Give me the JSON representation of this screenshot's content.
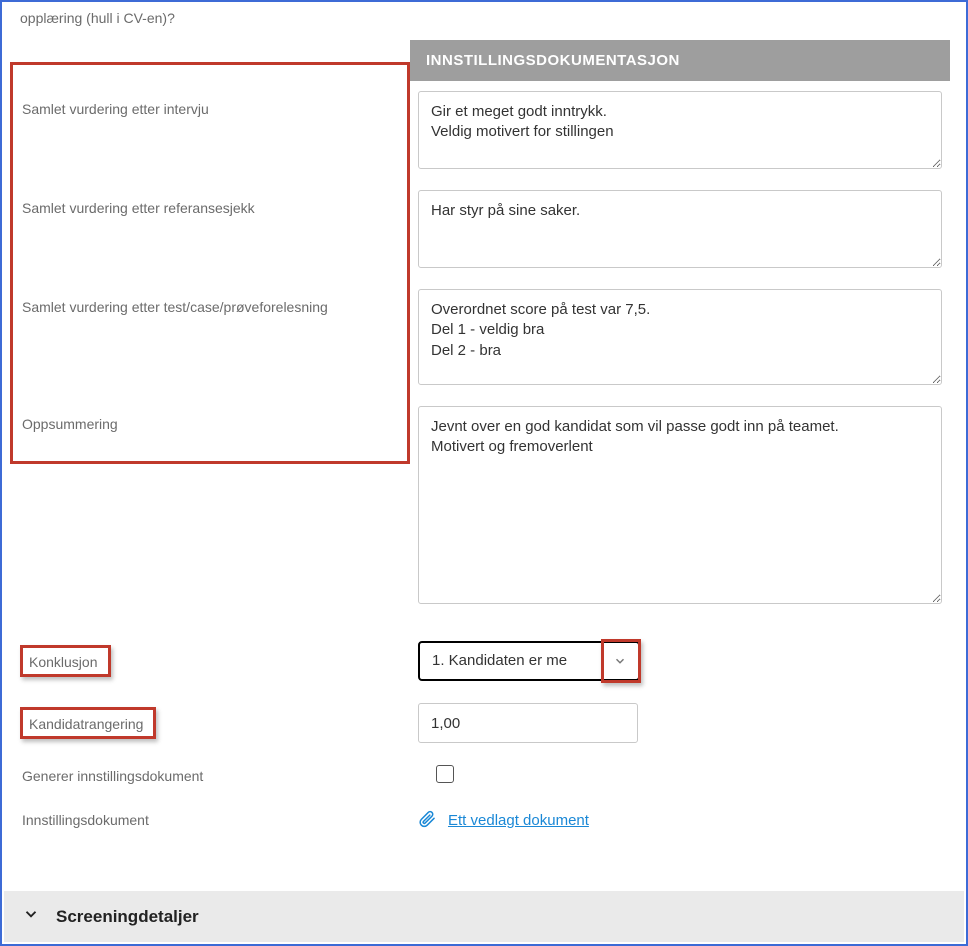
{
  "top_fragment": "opplæring (hull i CV-en)?",
  "section_header": "INNSTILLINGSDOKUMENTASJON",
  "labels": {
    "interview": "Samlet vurdering etter intervju",
    "reference": "Samlet vurdering etter referansesjekk",
    "testcase": "Samlet vurdering etter test/case/prøveforelesning",
    "summary": "Oppsummering",
    "conclusion": "Konklusjon",
    "ranking": "Kandidatrangering",
    "generate": "Generer innstillingsdokument",
    "document": "Innstillingsdokument"
  },
  "values": {
    "interview": "Gir et meget godt inntrykk.\nVeldig motivert for stillingen",
    "reference": "Har styr på sine saker.",
    "testcase": "Overordnet score på test var 7,5.\nDel 1 - veldig bra\nDel 2 - bra",
    "summary": "Jevnt over en god kandidat som vil passe godt inn på teamet.\nMotivert og fremoverlent",
    "conclusion_selected": "1. Kandidaten er me",
    "ranking": "1,00",
    "generate_checked": false,
    "document_link": "Ett vedlagt dokument"
  },
  "bottom_section": "Screeningdetaljer"
}
